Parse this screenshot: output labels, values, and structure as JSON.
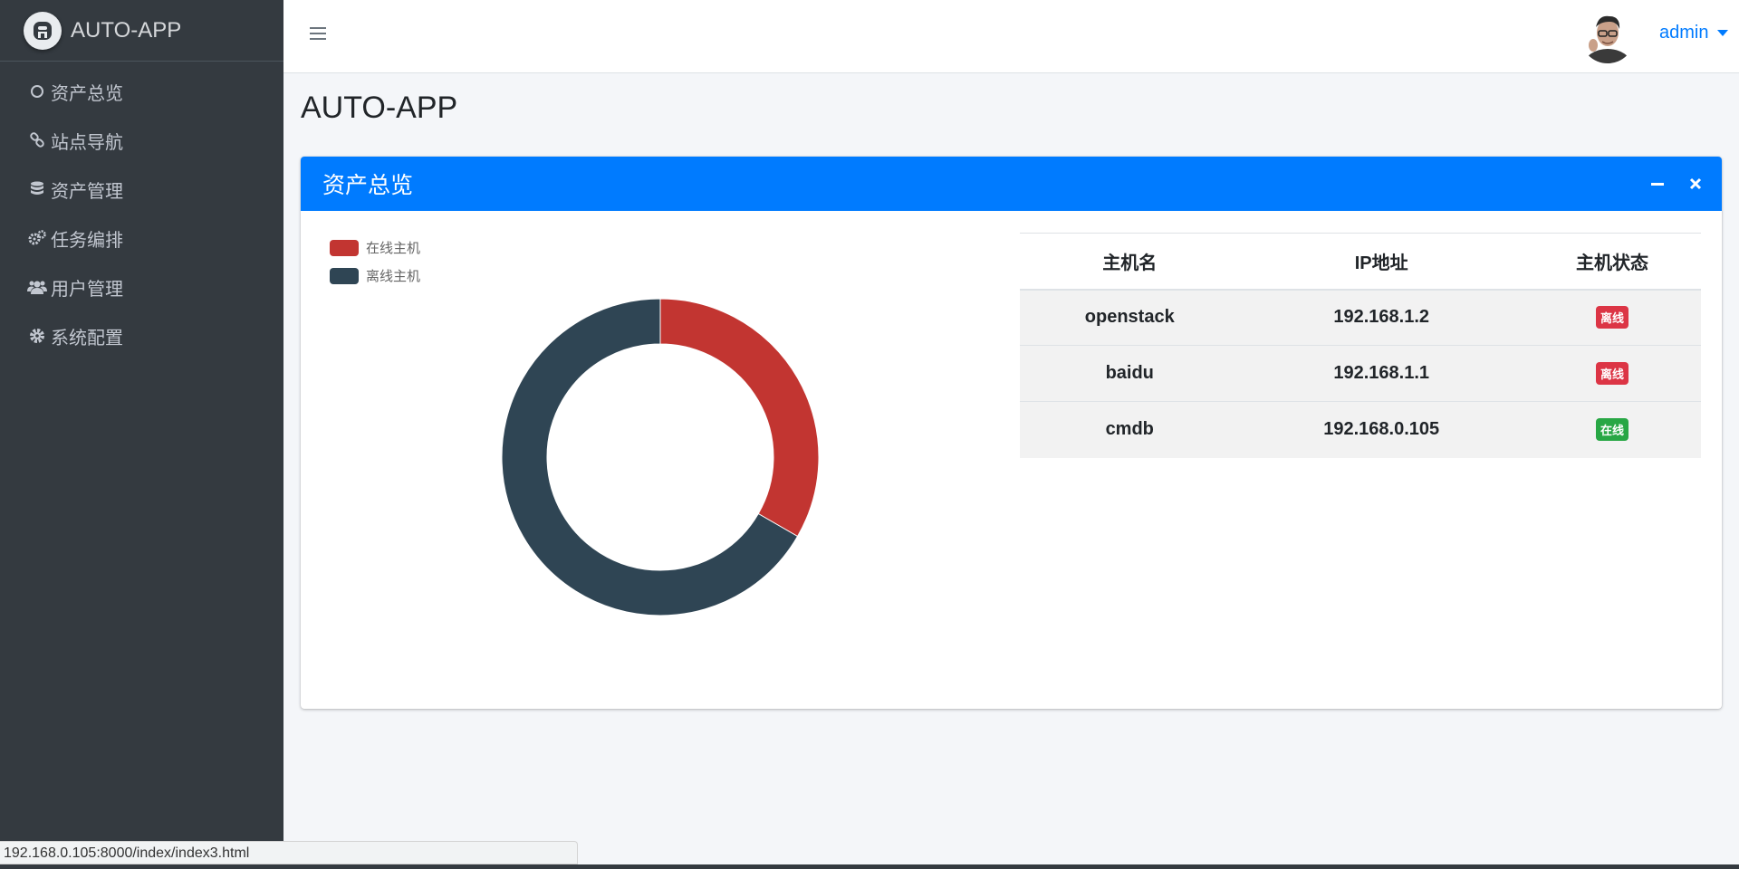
{
  "brand": {
    "name": "AUTO-APP"
  },
  "sidebar": {
    "items": [
      {
        "label": "资产总览",
        "icon": "circle-icon"
      },
      {
        "label": "站点导航",
        "icon": "link-icon"
      },
      {
        "label": "资产管理",
        "icon": "database-icon"
      },
      {
        "label": "任务编排",
        "icon": "cogs-icon"
      },
      {
        "label": "用户管理",
        "icon": "users-icon"
      },
      {
        "label": "系统配置",
        "icon": "gear-icon"
      }
    ]
  },
  "header": {
    "username": "admin"
  },
  "page": {
    "title": "AUTO-APP"
  },
  "card": {
    "title": "资产总览"
  },
  "legend": [
    {
      "label": "在线主机",
      "color": "#c23531"
    },
    {
      "label": "离线主机",
      "color": "#2f4554"
    }
  ],
  "chart_data": {
    "type": "pie",
    "donut": true,
    "labels": [
      "在线主机",
      "离线主机"
    ],
    "values": [
      1,
      2
    ],
    "colors": [
      "#c23531",
      "#2f4554"
    ],
    "legend_position": "top-left"
  },
  "table": {
    "headers": [
      "主机名",
      "IP地址",
      "主机状态"
    ],
    "rows": [
      {
        "host": "openstack",
        "ip": "192.168.1.2",
        "status": "离线",
        "status_color": "#dc3545"
      },
      {
        "host": "baidu",
        "ip": "192.168.1.1",
        "status": "离线",
        "status_color": "#dc3545"
      },
      {
        "host": "cmdb",
        "ip": "192.168.0.105",
        "status": "在线",
        "status_color": "#28a745"
      }
    ]
  },
  "statusbar": {
    "url": "192.168.0.105:8000/index/index3.html"
  },
  "colors": {
    "sidebar": "#343a40",
    "primary": "#007bff"
  }
}
